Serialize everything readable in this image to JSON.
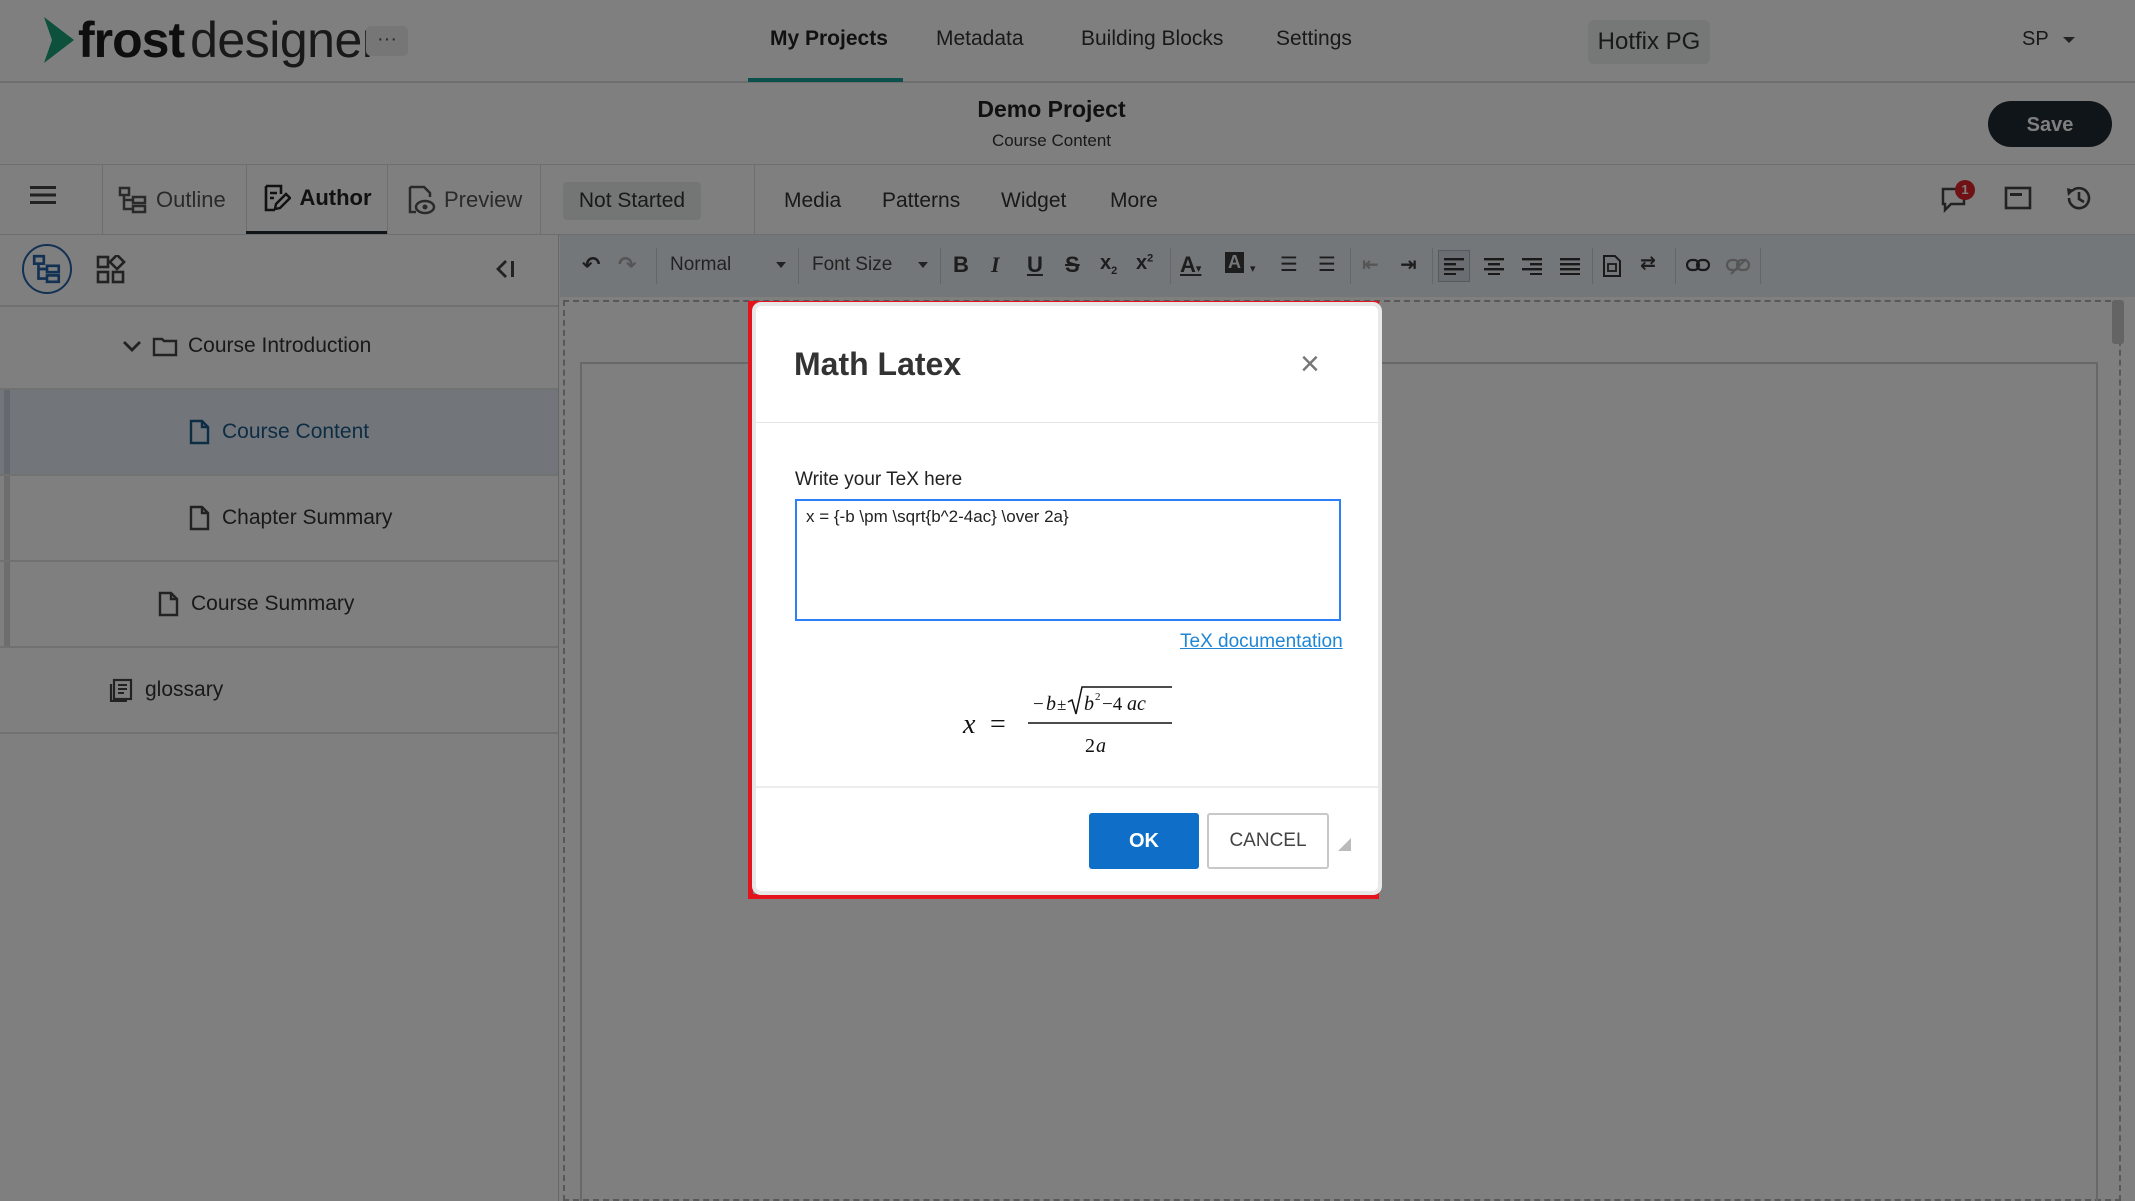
{
  "app": {
    "brand_bold": "frost",
    "brand_light": "designer",
    "more_label": "···"
  },
  "topnav": {
    "links": [
      "My Projects",
      "Metadata",
      "Building Blocks",
      "Settings"
    ],
    "workspace": "Hotfix PG",
    "user": "SP"
  },
  "project": {
    "title": "Demo Project",
    "subtitle": "Course Content",
    "save_label": "Save"
  },
  "toolbar": {
    "tabs": [
      "Outline",
      "Author",
      "Preview"
    ],
    "status": "Not Started",
    "menus": [
      "Media",
      "Patterns",
      "Widget",
      "More"
    ],
    "notification_count": "1"
  },
  "editor_toolbar": {
    "format": "Normal",
    "font_size": "Font Size"
  },
  "tree": {
    "items": [
      {
        "label": "Course Introduction",
        "type": "folder"
      },
      {
        "label": "Course Content",
        "type": "page",
        "selected": true
      },
      {
        "label": "Chapter Summary",
        "type": "page"
      },
      {
        "label": "Course Summary",
        "type": "page"
      },
      {
        "label": "glossary",
        "type": "glossary"
      }
    ]
  },
  "modal": {
    "title": "Math Latex",
    "close": "×",
    "label": "Write your TeX here",
    "tex_value": "x = {-b \\pm \\sqrt{b^2-4ac} \\over 2a}",
    "doc_link": "TeX documentation",
    "ok_label": "OK",
    "cancel_label": "CANCEL"
  },
  "colors": {
    "brand_green": "#1aa37a",
    "accent_teal": "#18a19a",
    "dark_button": "#1e2a33",
    "ok_blue": "#0e6ec8",
    "highlight_red": "#e3141e",
    "badge_red": "#e0232b",
    "link_blue": "#1f86d6"
  }
}
